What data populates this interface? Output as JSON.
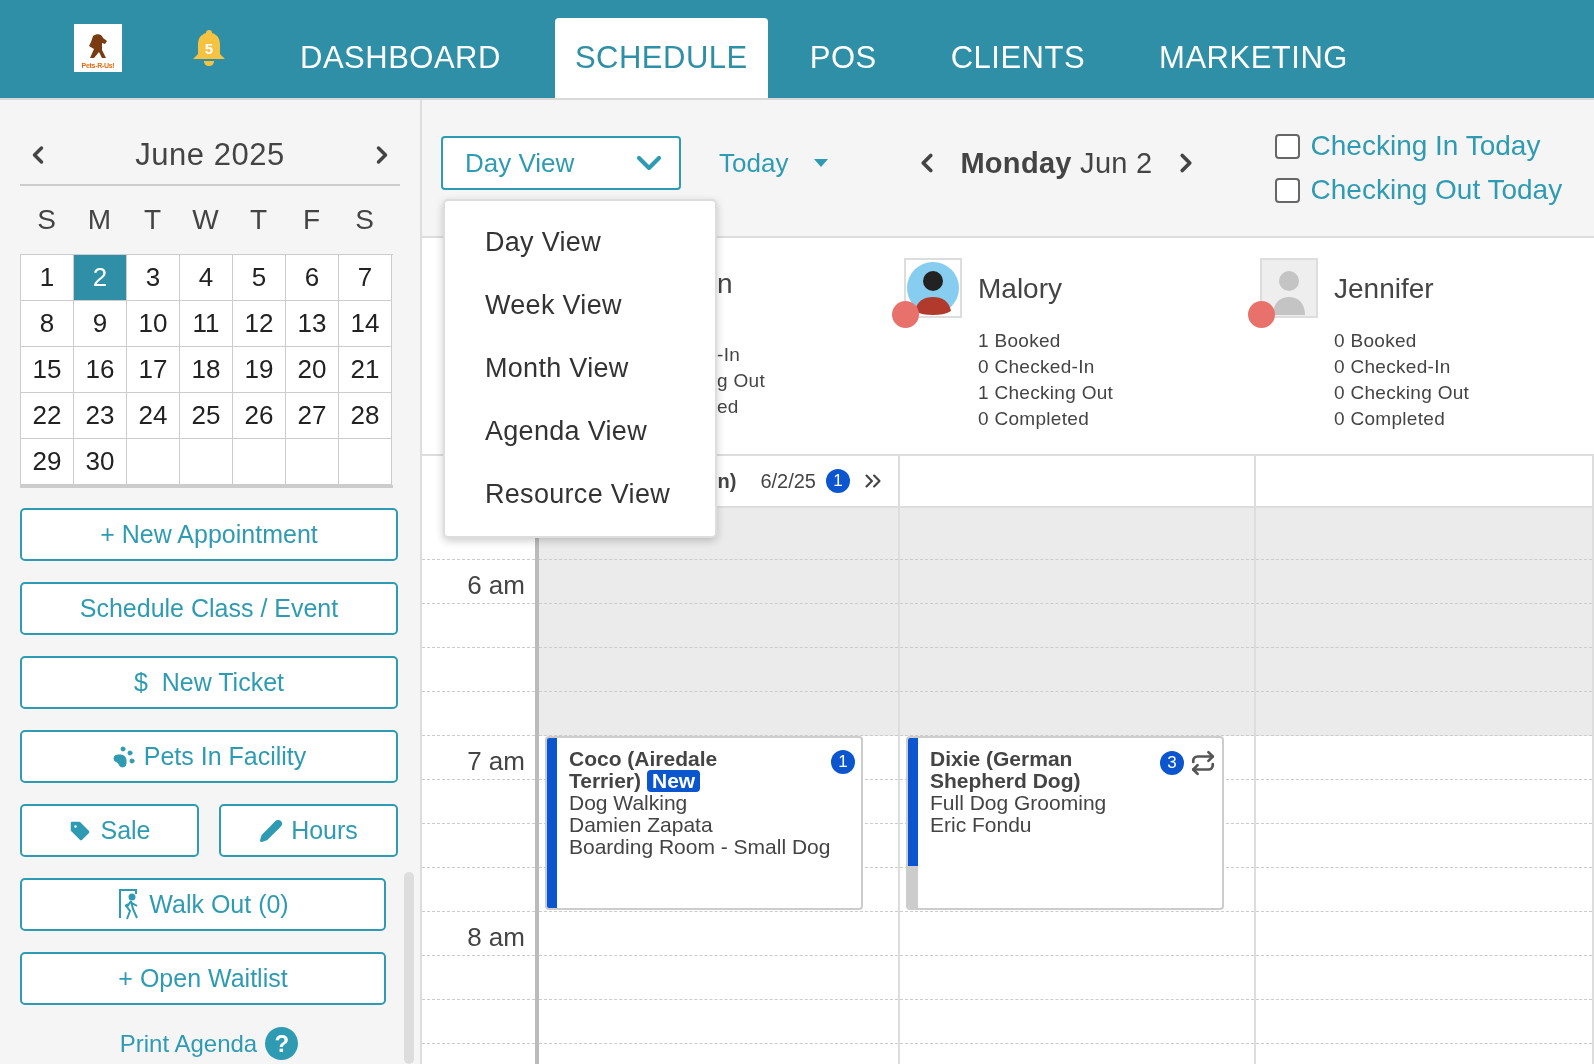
{
  "header": {
    "logo_text": "Pets-R-Us!",
    "notification_count": "5",
    "nav": [
      {
        "label": "DASHBOARD",
        "selected": false
      },
      {
        "label": "SCHEDULE",
        "selected": true
      },
      {
        "label": "POS",
        "selected": false
      },
      {
        "label": "CLIENTS",
        "selected": false
      },
      {
        "label": "MARKETING",
        "selected": false
      }
    ]
  },
  "calendar": {
    "month": "June 2025",
    "weekdays": [
      "S",
      "M",
      "T",
      "W",
      "T",
      "F",
      "S"
    ],
    "weeks": [
      [
        {
          "day": "1",
          "selected": false
        },
        {
          "day": "2",
          "selected": true
        },
        {
          "day": "3",
          "selected": false
        },
        {
          "day": "4",
          "selected": false
        },
        {
          "day": "5",
          "selected": false
        },
        {
          "day": "6",
          "selected": false
        },
        {
          "day": "7",
          "selected": false
        }
      ],
      [
        {
          "day": "8",
          "selected": false
        },
        {
          "day": "9",
          "selected": false
        },
        {
          "day": "10",
          "selected": false
        },
        {
          "day": "11",
          "selected": false
        },
        {
          "day": "12",
          "selected": false
        },
        {
          "day": "13",
          "selected": false
        },
        {
          "day": "14",
          "selected": false
        }
      ],
      [
        {
          "day": "15",
          "selected": false
        },
        {
          "day": "16",
          "selected": false
        },
        {
          "day": "17",
          "selected": false
        },
        {
          "day": "18",
          "selected": false
        },
        {
          "day": "19",
          "selected": false
        },
        {
          "day": "20",
          "selected": false
        },
        {
          "day": "21",
          "selected": false
        }
      ],
      [
        {
          "day": "22",
          "selected": false
        },
        {
          "day": "23",
          "selected": false
        },
        {
          "day": "24",
          "selected": false
        },
        {
          "day": "25",
          "selected": false
        },
        {
          "day": "26",
          "selected": false
        },
        {
          "day": "27",
          "selected": false
        },
        {
          "day": "28",
          "selected": false
        }
      ],
      [
        {
          "day": "29",
          "selected": false
        },
        {
          "day": "30",
          "selected": false
        }
      ]
    ]
  },
  "action_rows": [
    [
      {
        "label": "+ New Appointment",
        "kind": "plain"
      }
    ],
    [
      {
        "label": "Schedule Class / Event",
        "kind": "plain"
      }
    ],
    [
      {
        "label": "$  New Ticket",
        "kind": "plain"
      }
    ],
    [
      {
        "label": "Pets In Facility",
        "kind": "paw"
      }
    ],
    [
      {
        "label": "Sale",
        "kind": "tag"
      },
      {
        "label": "Hours",
        "kind": "pencil"
      }
    ],
    [
      {
        "label": "Walk Out (0)",
        "kind": "walkout"
      }
    ],
    [
      {
        "label": "+ Open Waitlist",
        "kind": "plain"
      }
    ]
  ],
  "print_agenda": {
    "label": "Print Agenda",
    "help_mark": "?"
  },
  "toolbar": {
    "view_select": "Day View",
    "today": "Today",
    "date": "**Monday** Jun 2",
    "filters": [
      {
        "label": "Checking In Today",
        "checked": false
      },
      {
        "label": "Checking Out Today",
        "checked": false
      }
    ]
  },
  "view_menu": [
    "Day View",
    "Week View",
    "Month View",
    "Agenda View",
    "Resource View"
  ],
  "staff": [
    {
      "kind": "partial",
      "name": "n",
      "stats": [
        "-In",
        "g Out",
        "ed"
      ],
      "summary": {
        "name": "n)",
        "date": "6/2/25",
        "count": "1"
      },
      "appointments": [
        {
          "title": "Coco (Airedale Terrier)",
          "badge": "New",
          "count": "1",
          "recurring": false,
          "lines": [
            "Dog Walking",
            "Damien Zapata",
            "Boarding Room - Small Dog"
          ]
        }
      ]
    },
    {
      "kind": "full",
      "name": "Malory",
      "avatar": {
        "kind": "photo"
      },
      "color": "#e8726b",
      "stats": [
        "1 Booked",
        "0 Checked-In",
        "1 Checking Out",
        "0 Completed"
      ],
      "appointments": [
        {
          "title": "Dixie (German Shepherd Dog)",
          "count": "3",
          "recurring": true,
          "lines": [
            "Full Dog Grooming",
            "Eric Fondu"
          ]
        }
      ]
    },
    {
      "kind": "full",
      "name": "Jennifer",
      "avatar": {
        "kind": "blank"
      },
      "color": "#e8726b",
      "stats": [
        "0 Booked",
        "0 Checked-In",
        "0 Checking Out",
        "0 Completed"
      ]
    }
  ],
  "times": [
    "6 am",
    "7 am",
    "8 am"
  ]
}
